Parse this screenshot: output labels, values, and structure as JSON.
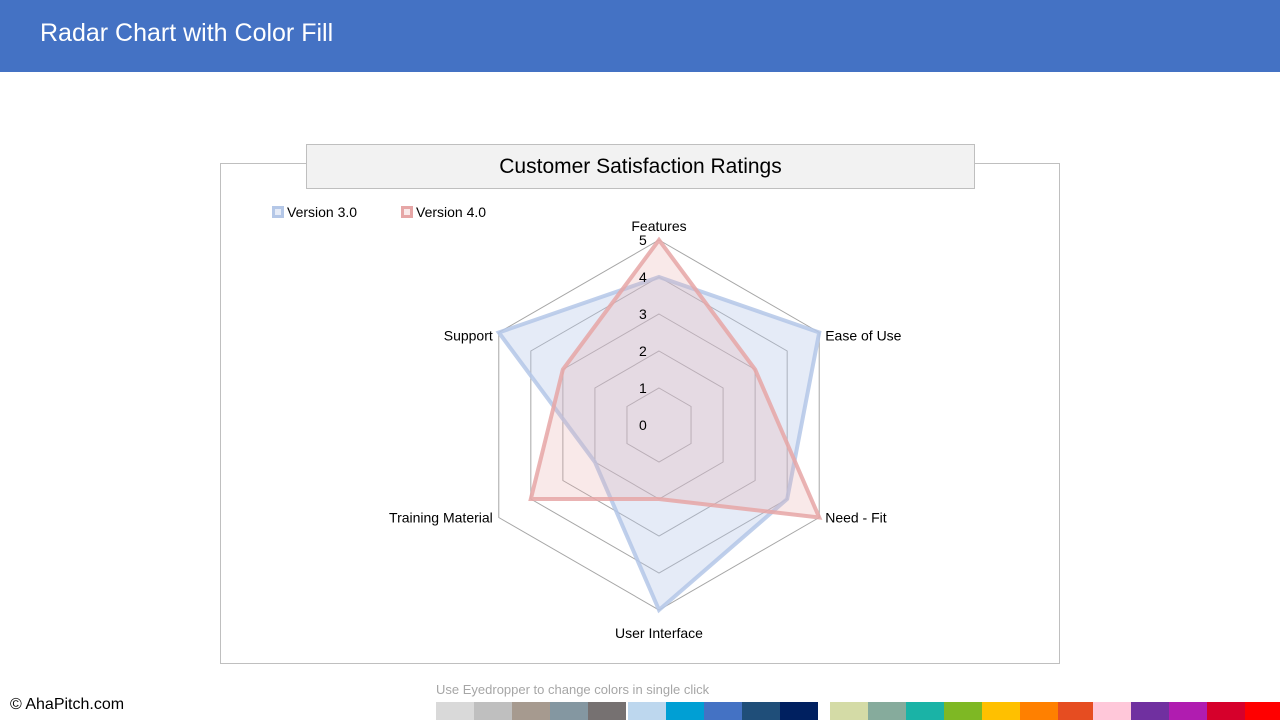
{
  "header": {
    "title": "Radar Chart with Color Fill"
  },
  "chart_data": {
    "type": "radar",
    "title": "Customer Satisfaction Ratings",
    "categories": [
      "Features",
      "Ease of Use",
      "Need - Fit",
      "User Interface",
      "Training Material",
      "Support"
    ],
    "series": [
      {
        "name": "Version 3.0",
        "values": [
          4,
          5,
          4,
          5,
          2,
          5
        ],
        "color": "#b4c7e7",
        "fill": "rgba(180,199,231,0.35)"
      },
      {
        "name": "Version 4.0",
        "values": [
          5,
          3,
          5,
          2,
          4,
          3
        ],
        "color": "#e6a6a6",
        "fill": "rgba(230,166,166,0.25)"
      }
    ],
    "rlim": [
      0,
      5
    ],
    "ticks": [
      "0",
      "1",
      "2",
      "3",
      "4",
      "5"
    ],
    "grid": true,
    "legend_position": "top-left"
  },
  "footer": {
    "copyright": "© AhaPitch.com",
    "hint": "Use Eyedropper to change colors in single click"
  },
  "palette": {
    "group1": [
      "#d9d9d9",
      "#bfbfbf",
      "#a69a8f",
      "#8497a1",
      "#767171"
    ],
    "group2": [
      "#bdd7ee",
      "#009fd4",
      "#4472c4",
      "#1f4e79",
      "#002060"
    ],
    "group3": [
      "#d4dba6",
      "#86ab9c",
      "#1ab3a6",
      "#7eb824",
      "#ffc000",
      "#ff8000",
      "#e64d21"
    ],
    "group4": [
      "#ffc7d9",
      "#7030a0",
      "#b01cb0",
      "#d6002b",
      "#ff0000"
    ]
  }
}
